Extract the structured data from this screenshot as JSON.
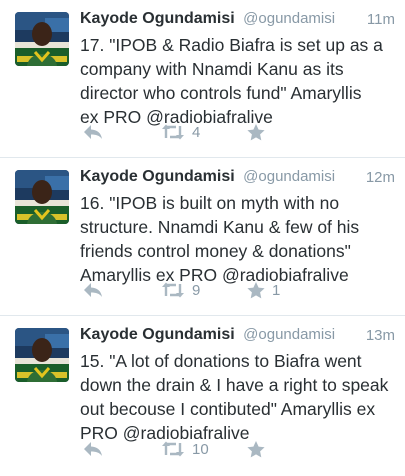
{
  "tweets": [
    {
      "name": "Kayode Ogundamisi",
      "handle": "@ogundamisi",
      "time": "11m",
      "lines": [
        "17. \"IPOB & Radio Biafra is set up as a",
        "company with Nnamdi Kanu as its",
        "director who controls fund\"  Amaryllis",
        "ex PRO @radiobiafralive"
      ],
      "retweets": "4",
      "likes": "",
      "icons": [
        "reply-icon",
        "retweet-icon",
        "like-icon"
      ]
    },
    {
      "name": "Kayode Ogundamisi",
      "handle": "@ogundamisi",
      "time": "12m",
      "lines": [
        "16. \"IPOB is built on myth with no",
        "structure. Nnamdi Kanu & few of his",
        "friends control money & donations\"",
        "Amaryllis ex PRO @radiobiafralive"
      ],
      "retweets": "9",
      "likes": "1",
      "icons": [
        "reply-icon",
        "retweet-icon",
        "like-icon"
      ]
    },
    {
      "name": "Kayode Ogundamisi",
      "handle": "@ogundamisi",
      "time": "13m",
      "lines": [
        "15. \"A lot of donations to Biafra went",
        "down the drain & I have a right to speak",
        "out becouse I contibuted\" Amaryllis ex",
        "PRO @radiobiafralive"
      ],
      "retweets": "10",
      "likes": "",
      "icons": [
        "reply-icon",
        "retweet-icon",
        "like-icon"
      ]
    }
  ],
  "colors": {
    "name": "#292f33",
    "muted": "#8899a6",
    "icon": "#aab8c2",
    "divider": "#e1e8ed"
  }
}
